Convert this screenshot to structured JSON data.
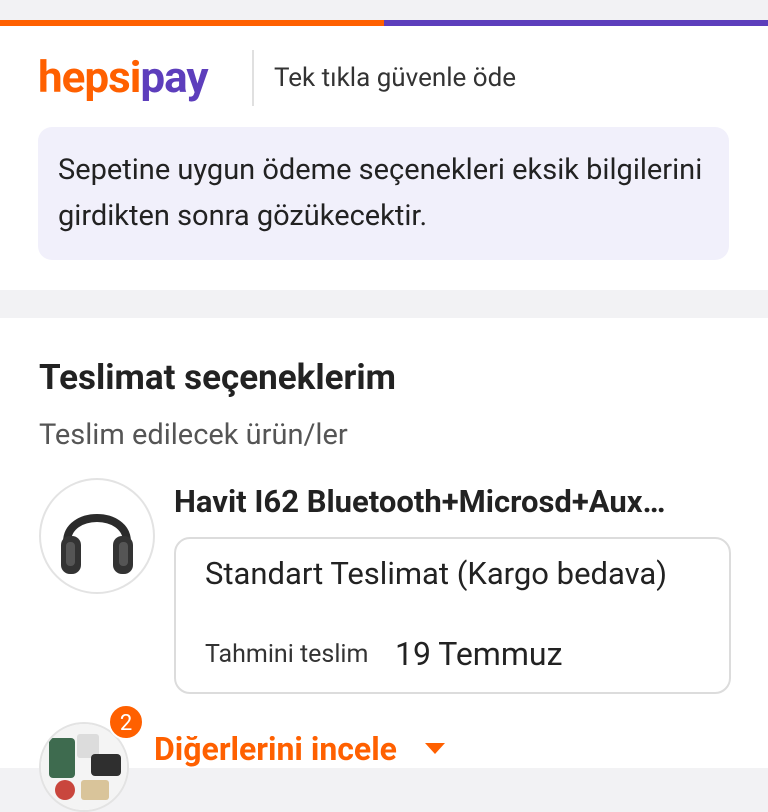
{
  "colors": {
    "brand_orange": "#ff6000",
    "brand_purple": "#5d3ebc",
    "info_bg": "#f1f0fb"
  },
  "header": {
    "logo_hepsi": "hepsi",
    "logo_pay": "pay",
    "tagline": "Tek tıkla güvenle öde"
  },
  "info": {
    "message": "Sepetine uygun ödeme seçenekleri eksik bilgilerini girdikten sonra gözükecektir."
  },
  "delivery": {
    "title": "Teslimat seçeneklerim",
    "subtitle": "Teslim edilecek ürün/ler",
    "product": {
      "name": "Havit I62 Bluetooth+Microsd+Aux…",
      "image_icon": "headphones-icon"
    },
    "option": {
      "title": "Standart Teslimat (Kargo bedava)",
      "eta_label": "Tahmini teslim",
      "eta_value": "19 Temmuz"
    },
    "others": {
      "count": "2",
      "label": "Diğerlerini incele",
      "icon": "chevron-down-icon"
    }
  }
}
